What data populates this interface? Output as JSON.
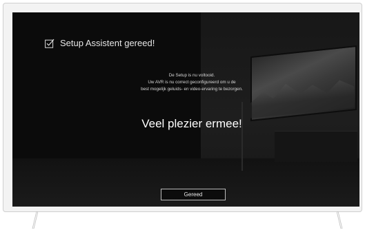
{
  "dialog": {
    "title": "Setup Assistent gereed!",
    "message_lines": [
      "De Setup is nu voltooid.",
      "Uw AVR is nu correct geconfigureerd om u de",
      "best mogelijk geluids- en video-ervaring te bezorgen."
    ],
    "big_text": "Veel plezier ermee!",
    "done_button": "Gereed"
  },
  "icons": {
    "check": "checkbox-checked-icon"
  },
  "colors": {
    "screen_background": "#0b0b0b",
    "text": "#ffffff",
    "frame": "#f3f3f3"
  }
}
